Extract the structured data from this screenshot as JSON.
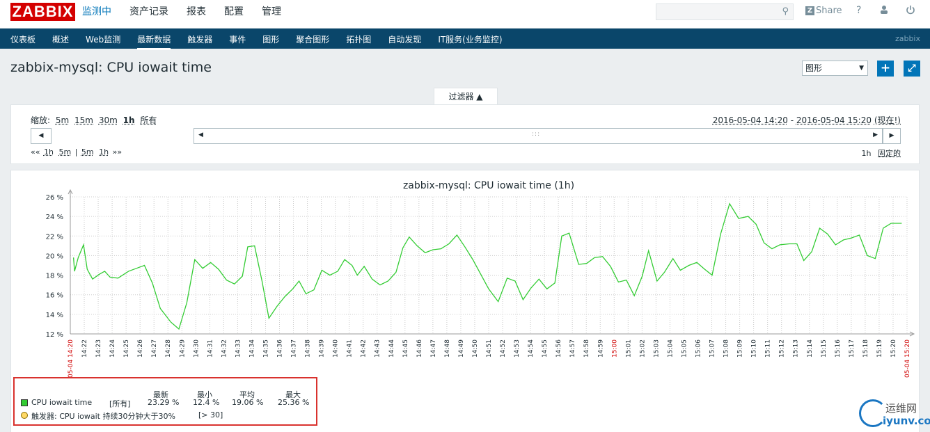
{
  "header": {
    "logo": "ZABBIX",
    "nav": [
      "监测中",
      "资产记录",
      "报表",
      "配置",
      "管理"
    ],
    "share": "Share",
    "help": "?"
  },
  "subnav": {
    "items": [
      "仪表板",
      "概述",
      "Web监测",
      "最新数据",
      "触发器",
      "事件",
      "图形",
      "聚合图形",
      "拓扑图",
      "自动发现",
      "IT服务(业务监控)"
    ],
    "active_index": 3,
    "right": "zabbix"
  },
  "page": {
    "title": "zabbix-mysql: CPU iowait time",
    "view_select": "图形",
    "add": "+",
    "fullscreen": "⤢"
  },
  "filter": {
    "tab_label": "过滤器 ▲",
    "zoom_label": "缩放:",
    "zoom_options": [
      "5m",
      "15m",
      "30m",
      "1h",
      "所有"
    ],
    "range_from": "2016-05-04 14:20",
    "range_sep": " - ",
    "range_to": "2016-05-04 15:20",
    "range_now": "(现在!)",
    "step_back": "««",
    "step_1h": "1h",
    "step_5m": "5m",
    "step_sep": "|",
    "step_5m_b": "5m",
    "step_1h_b": "1h",
    "step_fwd": "»»",
    "period": "1h",
    "fixed": "固定的"
  },
  "chart_data": {
    "type": "line",
    "title": "zabbix-mysql: CPU iowait time (1h)",
    "ylabel": "",
    "ylim": [
      12,
      26
    ],
    "y_ticks": [
      "12 %",
      "14 %",
      "16 %",
      "18 %",
      "20 %",
      "22 %",
      "24 %",
      "26 %"
    ],
    "x_ticks": [
      "05-04 14:20",
      "14:22",
      "14:23",
      "14:24",
      "14:25",
      "14:26",
      "14:27",
      "14:28",
      "14:29",
      "14:30",
      "14:31",
      "14:32",
      "14:33",
      "14:34",
      "14:35",
      "14:36",
      "14:37",
      "14:38",
      "14:39",
      "14:40",
      "14:41",
      "14:42",
      "14:43",
      "14:44",
      "14:45",
      "14:46",
      "14:47",
      "14:48",
      "14:49",
      "14:50",
      "14:51",
      "14:52",
      "14:53",
      "14:54",
      "14:55",
      "14:56",
      "14:57",
      "14:58",
      "14:59",
      "15:00",
      "15:01",
      "15:02",
      "15:03",
      "15:04",
      "15:05",
      "15:06",
      "15:07",
      "15:08",
      "15:09",
      "15:10",
      "15:11",
      "15:12",
      "15:13",
      "15:14",
      "15:15",
      "15:16",
      "15:17",
      "15:18",
      "15:19",
      "15:20",
      "05-04 15:20"
    ],
    "red_ticks": [
      "05-04 14:20",
      "15:00",
      "05-04 15:20"
    ],
    "grid": true,
    "line_color": "#33cc33",
    "series": [
      {
        "name": "CPU iowait time",
        "values": [
          [
            14.26,
            19.8
          ],
          [
            14.28,
            18.4
          ],
          [
            14.35,
            19.8
          ],
          [
            14.45,
            21.1
          ],
          [
            14.52,
            18.6
          ],
          [
            14.62,
            17.6
          ],
          [
            14.75,
            18.1
          ],
          [
            14.85,
            18.4
          ],
          [
            14.95,
            17.8
          ],
          [
            15.1,
            17.7
          ],
          [
            15.3,
            18.4
          ],
          [
            15.5,
            18.8
          ],
          [
            15.6,
            19.0
          ],
          [
            15.75,
            17.2
          ],
          [
            15.9,
            14.6
          ],
          [
            16.1,
            13.2
          ],
          [
            16.25,
            12.5
          ],
          [
            16.4,
            15.2
          ],
          [
            16.55,
            19.6
          ],
          [
            16.7,
            18.7
          ],
          [
            16.85,
            19.3
          ],
          [
            17.0,
            18.6
          ],
          [
            17.15,
            17.5
          ],
          [
            17.3,
            17.1
          ],
          [
            17.45,
            17.9
          ],
          [
            17.55,
            20.9
          ],
          [
            17.68,
            21.0
          ],
          [
            17.82,
            17.4
          ],
          [
            17.95,
            13.6
          ],
          [
            18.1,
            14.8
          ],
          [
            18.25,
            15.8
          ],
          [
            18.4,
            16.6
          ],
          [
            18.52,
            17.4
          ],
          [
            18.65,
            16.1
          ],
          [
            18.8,
            16.5
          ],
          [
            18.95,
            18.5
          ],
          [
            19.1,
            18.0
          ],
          [
            19.25,
            18.4
          ],
          [
            19.38,
            19.6
          ],
          [
            19.52,
            19.0
          ],
          [
            19.62,
            18.0
          ],
          [
            19.75,
            18.9
          ],
          [
            19.9,
            17.6
          ],
          [
            20.05,
            17.0
          ],
          [
            20.2,
            17.4
          ],
          [
            20.35,
            18.3
          ],
          [
            20.48,
            20.8
          ],
          [
            20.6,
            21.9
          ],
          [
            20.75,
            21.0
          ],
          [
            20.9,
            20.3
          ],
          [
            21.05,
            20.6
          ],
          [
            21.2,
            20.7
          ],
          [
            21.35,
            21.2
          ],
          [
            21.5,
            22.1
          ],
          [
            21.65,
            20.9
          ],
          [
            21.8,
            19.6
          ],
          [
            21.95,
            18.1
          ],
          [
            22.1,
            16.6
          ],
          [
            22.28,
            15.3
          ],
          [
            22.45,
            17.7
          ],
          [
            22.6,
            17.4
          ],
          [
            22.75,
            15.5
          ],
          [
            22.9,
            16.7
          ],
          [
            23.05,
            17.6
          ],
          [
            23.2,
            16.6
          ],
          [
            23.35,
            17.2
          ],
          [
            23.48,
            22.0
          ],
          [
            23.62,
            22.3
          ],
          [
            23.8,
            19.1
          ],
          [
            23.95,
            19.2
          ],
          [
            24.1,
            19.8
          ],
          [
            24.25,
            19.9
          ],
          [
            24.4,
            18.9
          ],
          [
            24.55,
            17.3
          ],
          [
            24.7,
            17.5
          ],
          [
            24.85,
            15.9
          ],
          [
            25.0,
            17.9
          ],
          [
            25.12,
            20.5
          ],
          [
            25.28,
            17.4
          ],
          [
            25.42,
            18.3
          ],
          [
            25.58,
            19.7
          ],
          [
            25.72,
            18.5
          ],
          [
            25.88,
            19.0
          ],
          [
            26.03,
            19.3
          ],
          [
            26.18,
            18.6
          ],
          [
            26.32,
            18.0
          ],
          [
            26.48,
            22.2
          ],
          [
            26.65,
            25.3
          ],
          [
            26.82,
            23.8
          ],
          [
            27.0,
            24.0
          ],
          [
            27.15,
            23.2
          ],
          [
            27.3,
            21.3
          ],
          [
            27.45,
            20.7
          ],
          [
            27.6,
            21.1
          ],
          [
            27.78,
            21.2
          ],
          [
            27.92,
            21.2
          ],
          [
            28.05,
            19.5
          ],
          [
            28.2,
            20.4
          ],
          [
            28.35,
            22.8
          ],
          [
            28.5,
            22.2
          ],
          [
            28.65,
            21.1
          ],
          [
            28.8,
            21.6
          ],
          [
            28.95,
            21.8
          ],
          [
            29.1,
            22.1
          ],
          [
            29.25,
            20.0
          ],
          [
            29.4,
            19.7
          ],
          [
            29.55,
            22.8
          ],
          [
            29.7,
            23.3
          ],
          [
            29.9,
            23.3
          ]
        ]
      }
    ]
  },
  "legend": {
    "headers": [
      "最新",
      "最小",
      "平均",
      "最大"
    ],
    "item_name": "CPU iowait time",
    "item_func": "[所有]",
    "last": "23.29 %",
    "min": "12.4 %",
    "avg": "19.06 %",
    "max": "25.36 %",
    "trigger_label": "触发器: CPU iowait 持续30分钟大于30%",
    "trigger_value": "[> 30]",
    "item_color": "#33cc33",
    "trigger_color": "#ffd966"
  },
  "watermark": {
    "cn": "运维网",
    "en": "iyunv.com"
  }
}
